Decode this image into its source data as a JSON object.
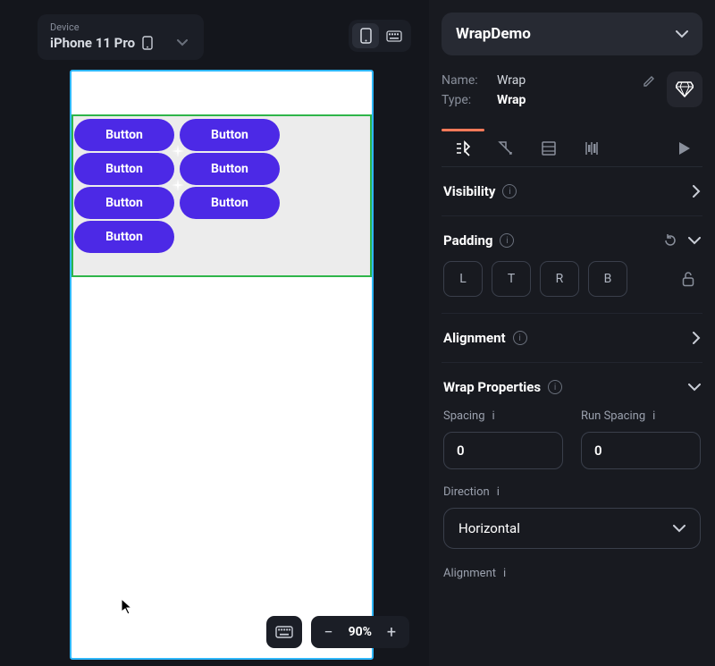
{
  "device": {
    "label": "Device",
    "name": "iPhone 11 Pro"
  },
  "canvas": {
    "buttons": [
      "Button",
      "Button",
      "Button",
      "Button",
      "Button",
      "Button",
      "Button"
    ]
  },
  "zoom": {
    "value": "90%"
  },
  "inspector": {
    "header": "WrapDemo",
    "name_label": "Name:",
    "name_value": "Wrap",
    "type_label": "Type:",
    "type_value": "Wrap",
    "visibility": "Visibility",
    "padding": {
      "title": "Padding",
      "L": "L",
      "T": "T",
      "R": "R",
      "B": "B"
    },
    "alignment": "Alignment",
    "wrap_props": {
      "title": "Wrap Properties",
      "spacing_label": "Spacing",
      "spacing_value": "0",
      "run_spacing_label": "Run Spacing",
      "run_spacing_value": "0",
      "direction_label": "Direction",
      "direction_value": "Horizontal",
      "alignment2": "Alignment"
    }
  }
}
